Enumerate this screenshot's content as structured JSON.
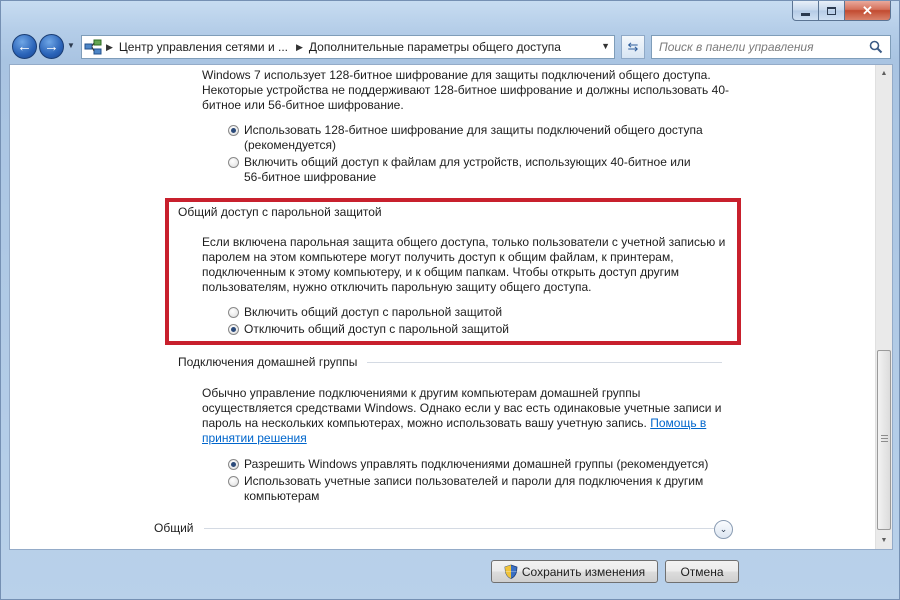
{
  "window": {
    "caption": {
      "minimize": "",
      "maximize": "",
      "close": "✕"
    }
  },
  "nav": {
    "back": "←",
    "forward": "→",
    "recent": "▼",
    "breadcrumb": [
      "Центр управления сетями и ...",
      "Дополнительные параметры общего доступа"
    ],
    "separator": "▶",
    "dropdown": "▼",
    "refresh": "⇆",
    "search_placeholder": "Поиск в панели управления"
  },
  "encryption": {
    "description": "Windows 7 использует 128-битное шифрование для защиты подключений общего доступа. Некоторые устройства не поддерживают 128-битное шифрование и должны использовать 40-битное или 56-битное шифрование.",
    "options": [
      {
        "label": "Использовать 128-битное шифрование для защиты подключений общего доступа (рекомендуется)",
        "checked": true
      },
      {
        "label": "Включить общий доступ к файлам для устройств, использующих 40-битное или 56-битное шифрование",
        "checked": false
      }
    ]
  },
  "password_protected": {
    "title": "Общий доступ с парольной защитой",
    "description": "Если включена парольная защита общего доступа, только пользователи с учетной записью и паролем на этом компьютере могут получить доступ к общим файлам, к принтерам, подключенным к этому компьютеру, и к общим папкам. Чтобы открыть доступ другим пользователям, нужно отключить парольную защиту общего доступа.",
    "options": [
      {
        "label": "Включить общий доступ с парольной защитой",
        "checked": false
      },
      {
        "label": "Отключить общий доступ с парольной защитой",
        "checked": true
      }
    ],
    "highlight_color": "#c8202d"
  },
  "homegroup": {
    "title": "Подключения домашней группы",
    "description": "Обычно управление подключениями к другим компьютерам домашней группы осуществляется средствами Windows. Однако если у вас есть одинаковые учетные записи и пароль на нескольких компьютерах, можно использовать вашу учетную запись.",
    "help_link": "Помощь в принятии решения",
    "options": [
      {
        "label": "Разрешить Windows управлять подключениями домашней группы (рекомендуется)",
        "checked": true
      },
      {
        "label": "Использовать учетные записи пользователей и пароли для подключения к другим компьютерам",
        "checked": false
      }
    ]
  },
  "general": {
    "title": "Общий",
    "expand": "⌄"
  },
  "footer": {
    "save_label": "Сохранить изменения",
    "cancel_label": "Отмена"
  }
}
